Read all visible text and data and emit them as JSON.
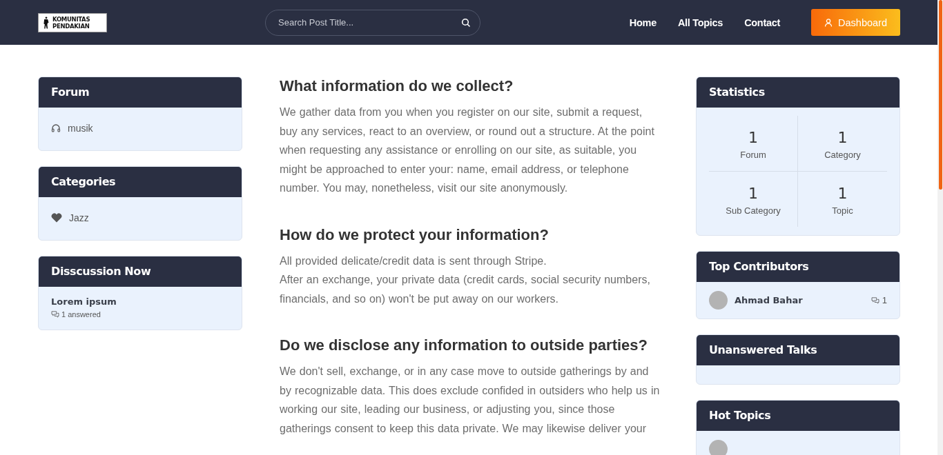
{
  "header": {
    "logo": [
      "KOMUNITAS",
      "PENDAKIAN"
    ],
    "search": {
      "placeholder": "Search Post Title..."
    },
    "nav": [
      "Home",
      "All Topics",
      "Contact"
    ],
    "dashboard": "Dashboard"
  },
  "left": {
    "forum": {
      "title": "Forum",
      "items": [
        "musik"
      ]
    },
    "categories": {
      "title": "Categories",
      "items": [
        "Jazz"
      ]
    },
    "discussion": {
      "title": "Disscussion Now",
      "items": [
        {
          "title": "Lorem ipsum",
          "answered": "1 answered"
        }
      ]
    }
  },
  "sections": [
    {
      "heading": "What information do we collect?",
      "paragraphs": [
        "We gather data from you when you register on our site, submit a request, buy any services, react to an overview, or round out a structure. At the point when requesting any assistance or enrolling on our site, as suitable, you might be approached to enter your: name, email address, or telephone number. You may, nonetheless, visit our site anonymously."
      ]
    },
    {
      "heading": "How do we protect your information?",
      "paragraphs": [
        "All provided delicate/credit data is sent through Stripe.",
        "After an exchange, your private data (credit cards, social security numbers, financials, and so on) won't be put away on our workers."
      ]
    },
    {
      "heading": "Do we disclose any information to outside parties?",
      "paragraphs": [
        "We don't sell, exchange, or in any case move to outside gatherings by and by recognizable data. This does exclude confided in outsiders who help us in working our site, leading our business, or adjusting you, since those gatherings consent to keep this data private. We may likewise deliver your"
      ]
    }
  ],
  "right": {
    "statistics": {
      "title": "Statistics",
      "items": [
        {
          "value": "1",
          "label": "Forum"
        },
        {
          "value": "1",
          "label": "Category"
        },
        {
          "value": "1",
          "label": "Sub Category"
        },
        {
          "value": "1",
          "label": "Topic"
        }
      ]
    },
    "contributors": {
      "title": "Top Contributors",
      "items": [
        {
          "name": "Ahmad Bahar",
          "count": "1"
        }
      ]
    },
    "unanswered": {
      "title": "Unanswered Talks"
    },
    "hot": {
      "title": "Hot Topics"
    }
  }
}
